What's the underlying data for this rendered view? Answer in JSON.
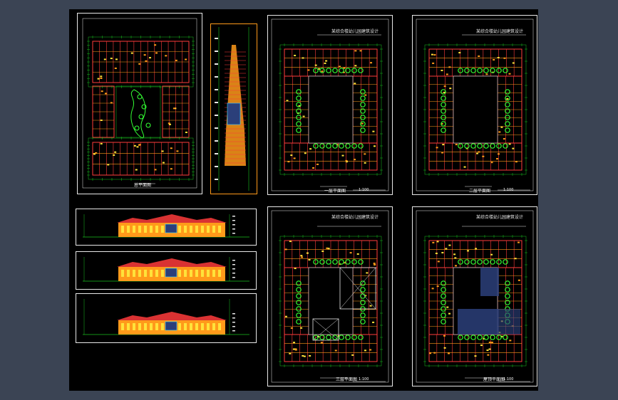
{
  "window": {
    "background": "#3b4454",
    "canvas_background": "#000000"
  },
  "colors": {
    "frame": "#e8e8e8",
    "wall_red": "#ff3b3b",
    "orange": "#ff9a1a",
    "yellow": "#ffe23a",
    "green_dim": "#18c21e",
    "green_tree": "#33ff33",
    "blue_tile": "#2b3f7a",
    "cyan": "#3ad6ff"
  },
  "sheets": {
    "site_plan": {
      "caption": "总平面图"
    },
    "section": {
      "caption": ""
    },
    "elevation_1": {
      "caption": ""
    },
    "elevation_2": {
      "caption": ""
    },
    "elevation_3": {
      "caption": ""
    },
    "plan_1": {
      "title": "某综合楼幼儿园建筑设计",
      "caption": "一层平面图",
      "scale": "1:100"
    },
    "plan_2": {
      "title": "某综合楼幼儿园建筑设计",
      "caption": "二层平面图",
      "scale": "1:100"
    },
    "plan_3": {
      "title": "某综合楼幼儿园建筑设计",
      "caption": "三层平面图",
      "scale": "1:100"
    },
    "plan_4": {
      "title": "某综合楼幼儿园建筑设计",
      "caption": "屋顶平面图",
      "scale": "1:100"
    }
  }
}
